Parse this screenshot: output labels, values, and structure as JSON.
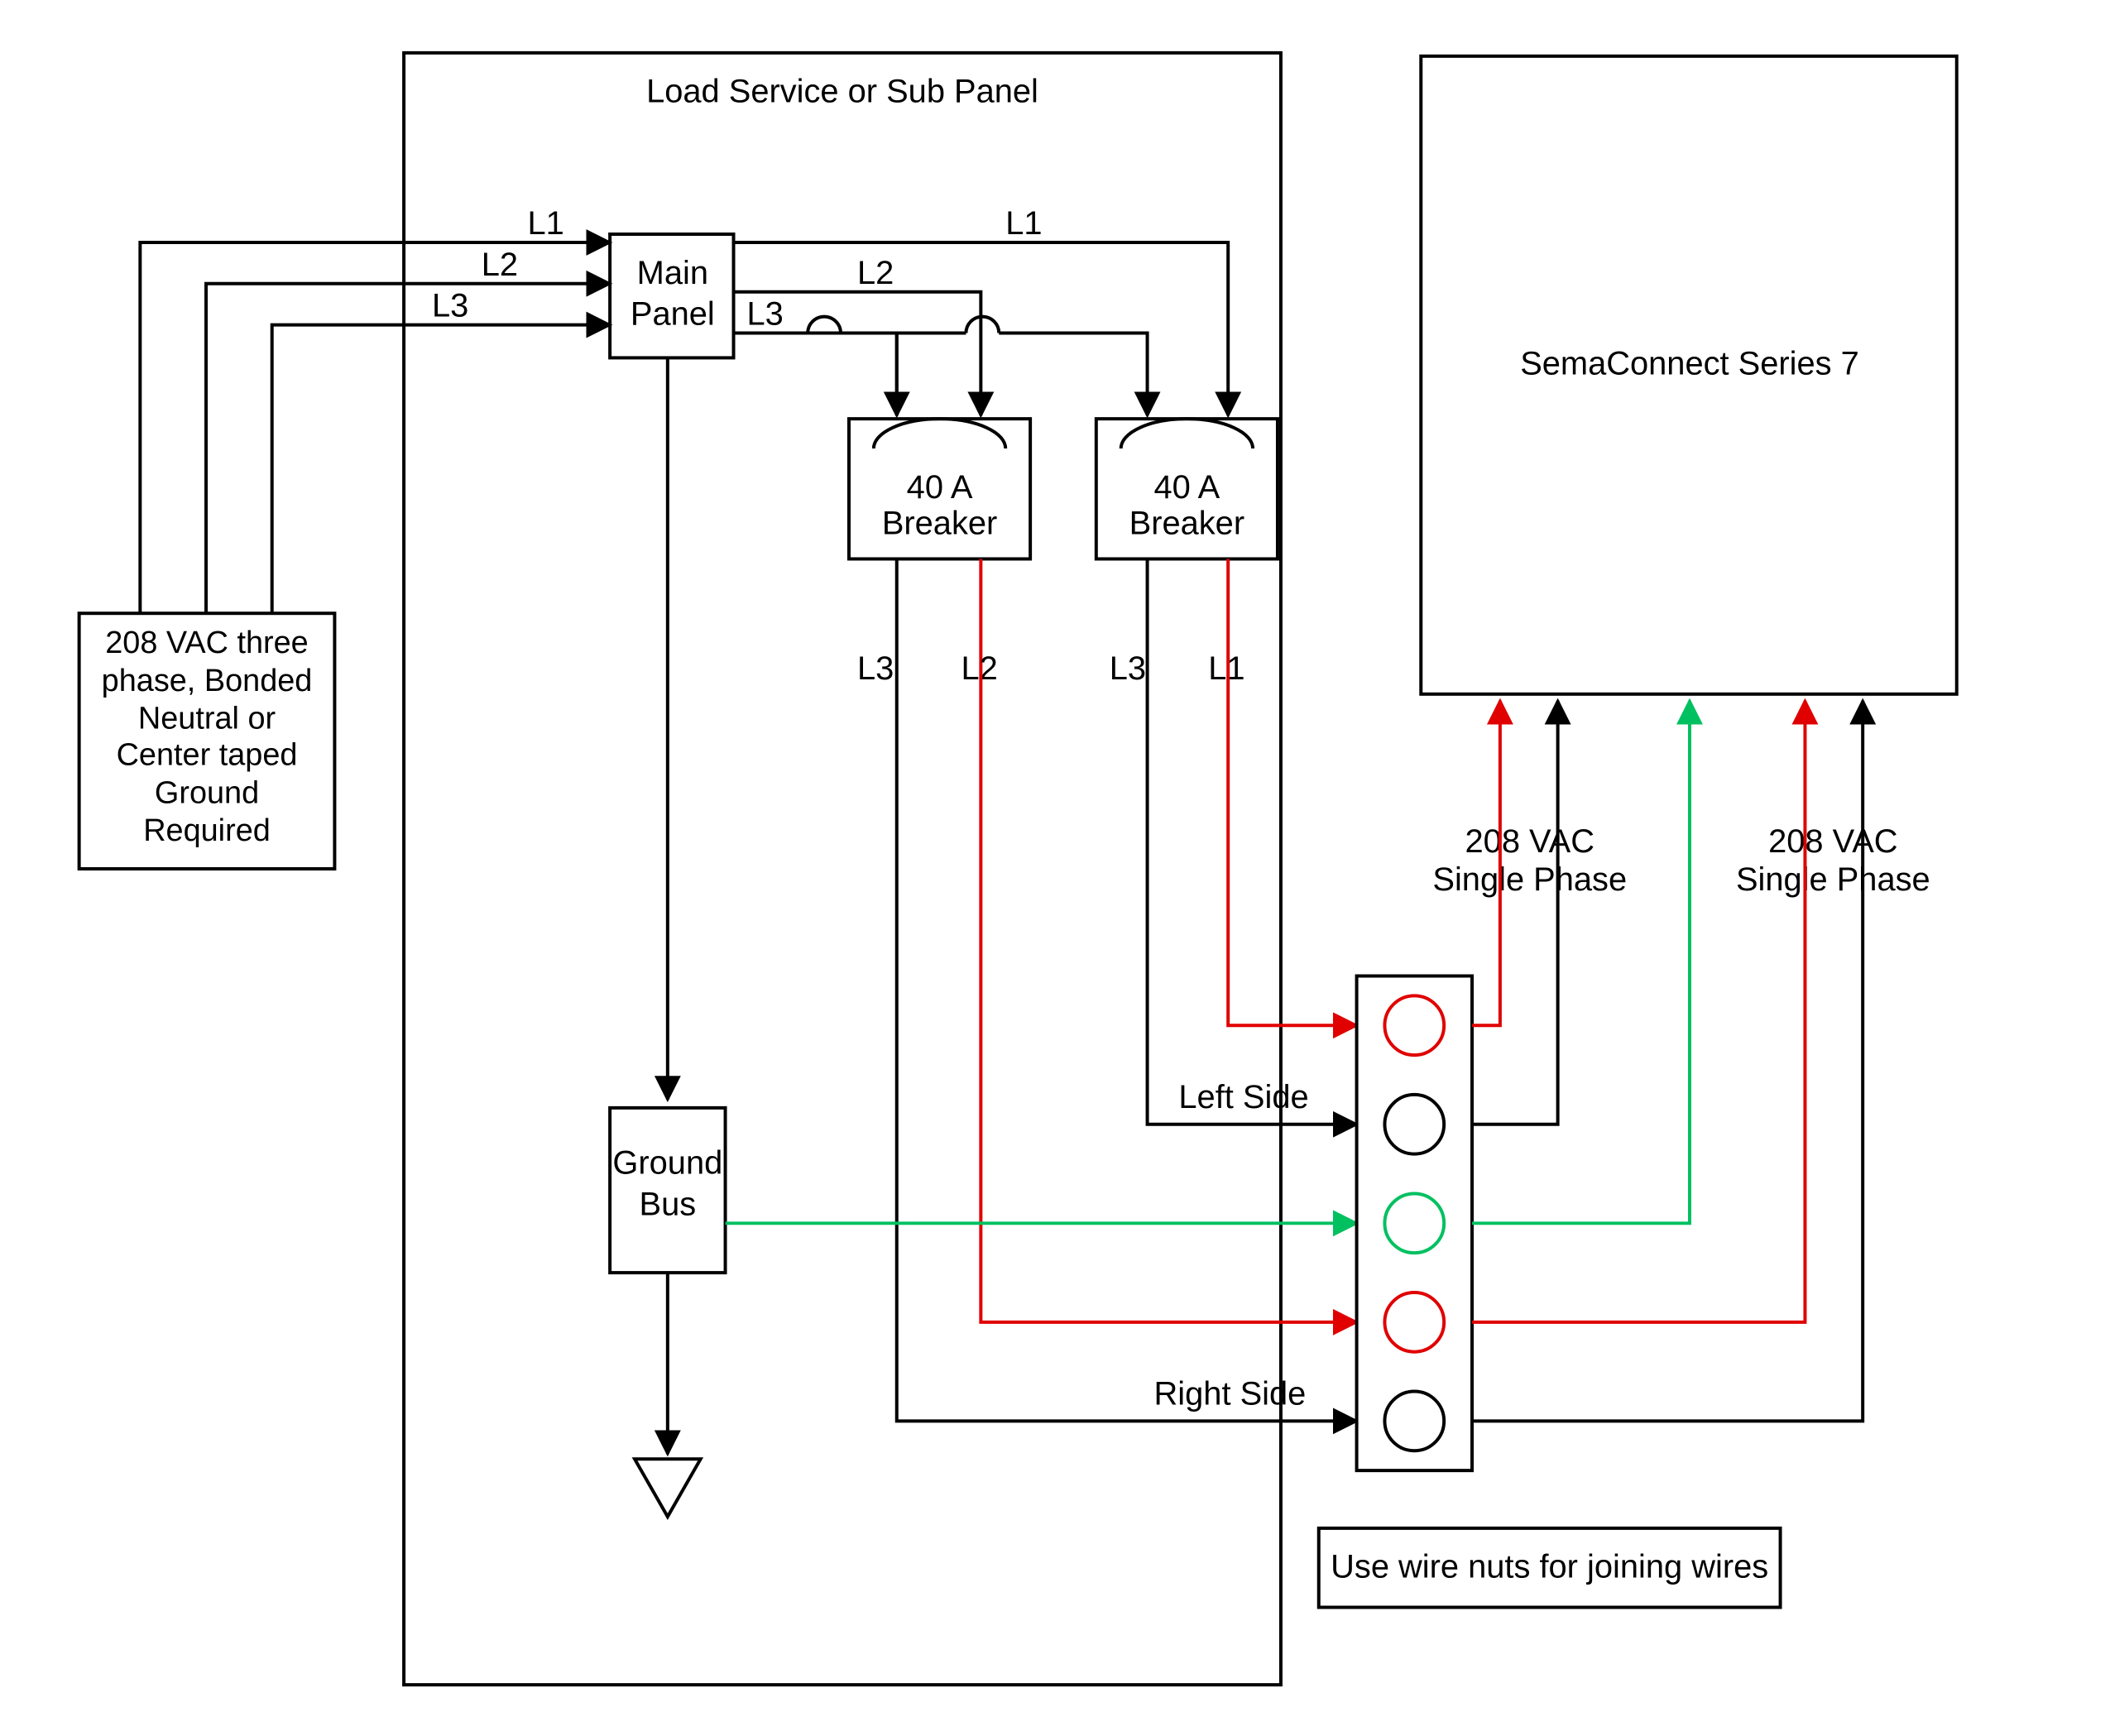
{
  "panel_title": "Load Service or Sub Panel",
  "source_box": "208 VAC three phase, Bonded Neutral or Center taped Ground Required",
  "main_panel": "Main Panel",
  "breaker1": "40 A Breaker",
  "breaker2": "40 A Breaker",
  "ground_bus": "Ground Bus",
  "device": "SemaConnect Series 7",
  "left_side": "Left Side",
  "right_side": "Right Side",
  "wire_nuts": "Use wire nuts for joining wires",
  "phase_a": "208 VAC Single Phase",
  "phase_b": "208 VAC Single Phase",
  "L1": "L1",
  "L2": "L2",
  "L3": "L3"
}
